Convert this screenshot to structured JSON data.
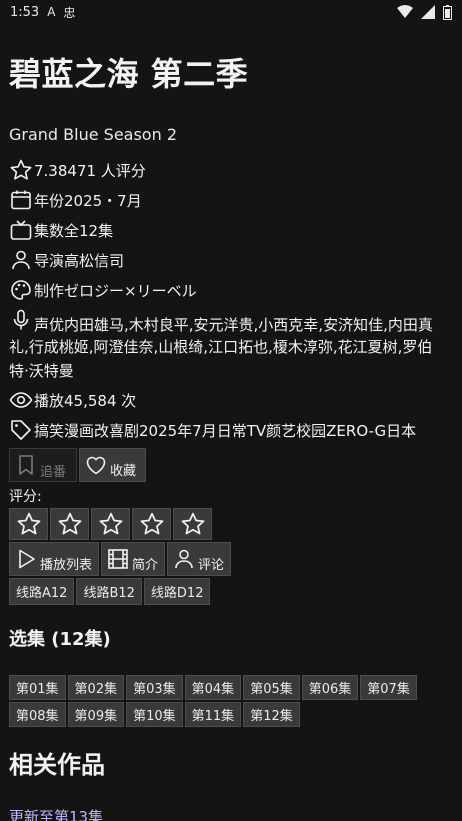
{
  "status": {
    "time": "1:53",
    "icons": [
      "A",
      "忠"
    ]
  },
  "title": "碧蓝之海 第二季",
  "subtitle": "Grand Blue Season 2",
  "meta": {
    "rating": "7.38471 人评分",
    "year": "年份2025・7月",
    "episodes": "集数全12集",
    "director": "导演高松信司",
    "studio": "制作ゼロジー×リーベル",
    "cast_line1": "声优内田雄马,木村良平,安元洋贵,小西克幸,安济知佳,内田真",
    "cast_line2": "礼,行成桃姬,阿澄佳奈,山根绮,江口拓也,榎木淳弥,花江夏树,罗伯",
    "cast_line3": "特·沃特曼",
    "plays": "播放45,584 次",
    "tags": "搞笑漫画改喜剧2025年7月日常TV颜艺校园ZERO-G日本"
  },
  "actions": {
    "follow": "追番",
    "favorite": "收藏"
  },
  "rating_label": "评分:",
  "tabs": {
    "playlist": "播放列表",
    "intro": "简介",
    "comments": "评论"
  },
  "lines": [
    "线路A12",
    "线路B12",
    "线路D12"
  ],
  "episodes_heading": "选集 (12集)",
  "episodes": [
    "第01集",
    "第02集",
    "第03集",
    "第04集",
    "第05集",
    "第06集",
    "第07集",
    "第08集",
    "第09集",
    "第10集",
    "第11集",
    "第12集"
  ],
  "related_heading": "相关作品",
  "update_link": "更新至第13集"
}
